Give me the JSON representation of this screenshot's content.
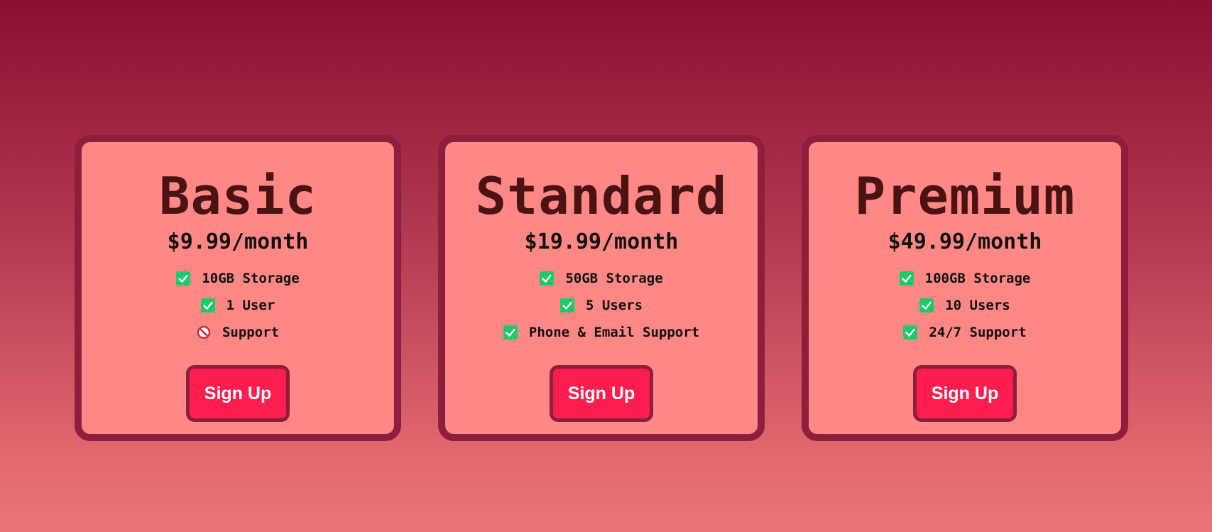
{
  "plans": [
    {
      "name": "Basic",
      "price": "$9.99/month",
      "features": [
        {
          "label": "10GB Storage",
          "included": true
        },
        {
          "label": "1 User",
          "included": true
        },
        {
          "label": "Support",
          "included": false
        }
      ],
      "cta_label": "Sign Up"
    },
    {
      "name": "Standard",
      "price": "$19.99/month",
      "features": [
        {
          "label": "50GB Storage",
          "included": true
        },
        {
          "label": "5 Users",
          "included": true
        },
        {
          "label": "Phone & Email Support",
          "included": true
        }
      ],
      "cta_label": "Sign Up"
    },
    {
      "name": "Premium",
      "price": "$49.99/month",
      "features": [
        {
          "label": "100GB Storage",
          "included": true
        },
        {
          "label": "10 Users",
          "included": true
        },
        {
          "label": "24/7 Support",
          "included": true
        }
      ],
      "cta_label": "Sign Up"
    }
  ],
  "icons": {
    "included": "check-icon",
    "excluded": "prohibited-icon"
  },
  "colors": {
    "card_background": "#ff8884",
    "card_border": "#8c1f3e",
    "check_green": "#1dc96a",
    "button_background": "#ff1e4e",
    "prohibited_red": "#e0243a"
  }
}
